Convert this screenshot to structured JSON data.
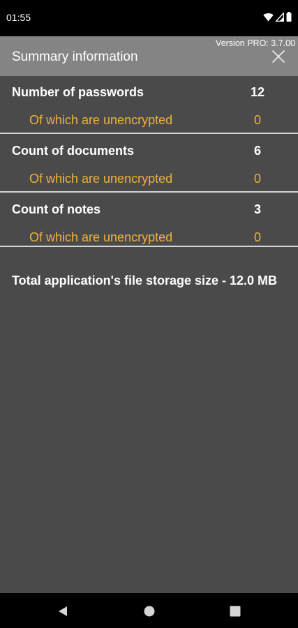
{
  "status_bar": {
    "time": "01:55",
    "icons": [
      "wifi-icon",
      "signal-icon",
      "battery-icon"
    ]
  },
  "header": {
    "version": "Version PRO: 3.7.00",
    "title": "Summary information",
    "close_icon": "close-icon"
  },
  "sections": [
    {
      "label": "Number of passwords",
      "value": "12",
      "sub_label": "Of which are unencrypted",
      "sub_value": "0"
    },
    {
      "label": "Count of documents",
      "value": "6",
      "sub_label": "Of which are unencrypted",
      "sub_value": "0"
    },
    {
      "label": "Count of notes",
      "value": "3",
      "sub_label": "Of which are unencrypted",
      "sub_value": "0"
    }
  ],
  "total_storage": "Total application's file storage size - 12.0 MB",
  "nav_bar": {
    "icons": [
      "back-icon",
      "home-icon",
      "recents-icon"
    ]
  },
  "colors": {
    "background": "#4a4a4a",
    "header": "#848484",
    "accent": "#f0b13c",
    "divider": "#d4d4d4"
  }
}
